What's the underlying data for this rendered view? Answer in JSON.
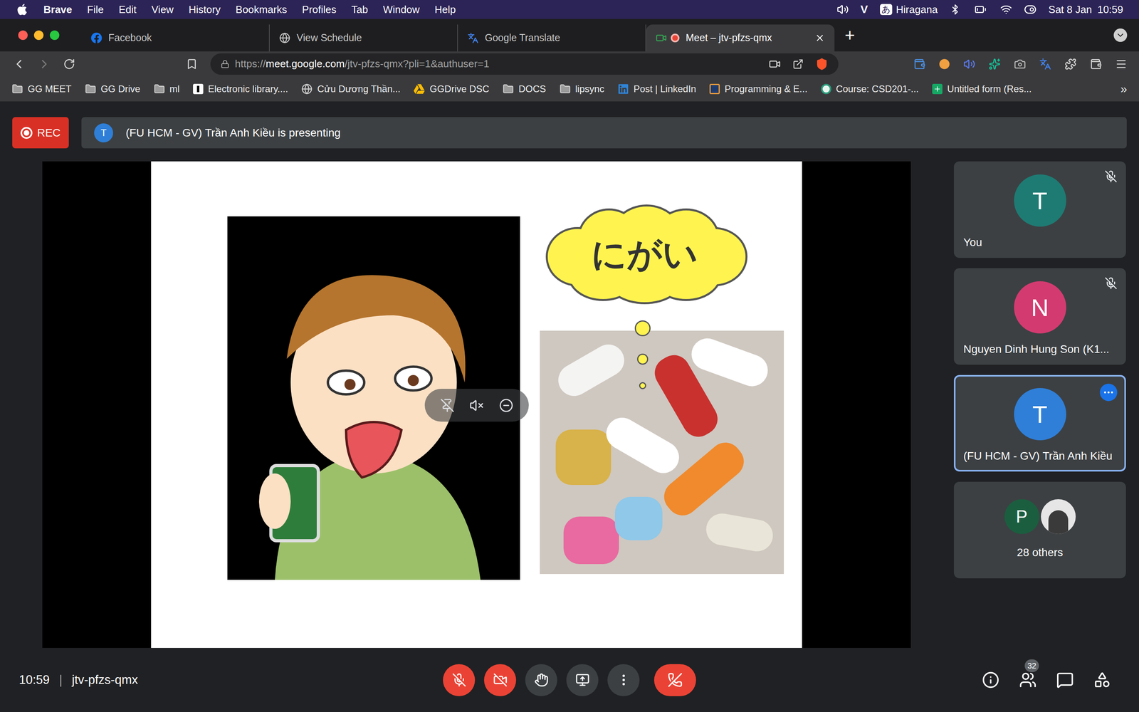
{
  "menubar": {
    "app": "Brave",
    "items": [
      "File",
      "Edit",
      "View",
      "History",
      "Bookmarks",
      "Profiles",
      "Tab",
      "Window",
      "Help"
    ],
    "status": {
      "vivaldi": "V",
      "input_icon": "あ",
      "input_method": "Hiragana",
      "date": "Sat 8 Jan",
      "time": "10:59"
    }
  },
  "browser": {
    "tabs": [
      {
        "label": "Facebook",
        "kind": "facebook",
        "selected": false,
        "recording": false
      },
      {
        "label": "View Schedule",
        "kind": "globe",
        "selected": false,
        "recording": false
      },
      {
        "label": "Google Translate",
        "kind": "translate",
        "selected": false,
        "recording": false
      },
      {
        "label": "Meet – jtv-pfzs-qmx",
        "kind": "meet",
        "selected": true,
        "recording": true
      }
    ],
    "new_tab": "+",
    "url": {
      "scheme": "https://",
      "host": "meet.google.com",
      "path": "/jtv-pfzs-qmx?pli=1&authuser=1"
    },
    "bookmarks": [
      {
        "label": "GG MEET",
        "kind": "folder"
      },
      {
        "label": "GG Drive",
        "kind": "folder"
      },
      {
        "label": "ml",
        "kind": "folder"
      },
      {
        "label": "Electronic library....",
        "kind": "library"
      },
      {
        "label": "Cửu Dương Thần...",
        "kind": "site"
      },
      {
        "label": "GGDrive DSC",
        "kind": "drive"
      },
      {
        "label": "DOCS",
        "kind": "folder"
      },
      {
        "label": "lipsync",
        "kind": "folder"
      },
      {
        "label": "Post | LinkedIn",
        "kind": "linkedin"
      },
      {
        "label": "Programming & E...",
        "kind": "blog"
      },
      {
        "label": "Course: CSD201-...",
        "kind": "course"
      },
      {
        "label": "Untitled form (Res...",
        "kind": "form"
      }
    ],
    "bookmarks_overflow": "»"
  },
  "meet": {
    "recording": "REC",
    "presenter_banner": {
      "initial": "T",
      "text": "(FU HCM - GV) Trần Anh Kiều is presenting"
    },
    "slide": {
      "word": "にがい"
    },
    "tiles": [
      {
        "initial": "T",
        "name": "You",
        "color": "#1e7b73",
        "muted": true,
        "selected": false
      },
      {
        "initial": "N",
        "name": "Nguyen Dinh Hung Son (K1...",
        "color": "#d33b70",
        "muted": true,
        "selected": false
      },
      {
        "initial": "T",
        "name": "(FU HCM - GV) Trần Anh Kiều",
        "color": "#2f7fd8",
        "muted": false,
        "selected": true
      }
    ],
    "others": {
      "initial": "P",
      "color": "#1b5e3f",
      "label": "28 others"
    },
    "time": "10:59",
    "separator": "|",
    "code": "jtv-pfzs-qmx",
    "controls": {
      "mic_on": false,
      "camera_on": false
    },
    "participant_count": "32"
  }
}
